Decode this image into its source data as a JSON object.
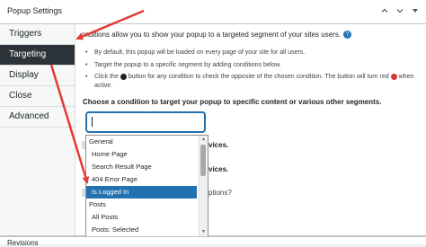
{
  "panel": {
    "title": "Popup Settings",
    "tools": {
      "up_icon": "chevron-up-icon",
      "down_icon": "chevron-down-icon",
      "toggle_icon": "triangle-toggle-icon"
    }
  },
  "tabs": [
    {
      "label": "Triggers",
      "active": false
    },
    {
      "label": "Targeting",
      "active": true
    },
    {
      "label": "Display",
      "active": false
    },
    {
      "label": "Close",
      "active": false
    },
    {
      "label": "Advanced",
      "active": false
    }
  ],
  "targeting": {
    "intro": "onditions allow you to show your popup to a targeted segment of your sites users.",
    "bullets": {
      "b1": "By default, this popup will be loaded on every page of your site for all users.",
      "b2": "Target the popup to a specific segment by adding conditions below.",
      "b3_part1": "Click the",
      "b3_part2": "button for any condition to check the opposite of the chosen condition. The button will turn red",
      "b3_part3": "when active."
    },
    "heading": "Choose a condition to target your popup to specific content or various other segments.",
    "select_value": ""
  },
  "dropdown": {
    "groups": [
      {
        "label": "General",
        "items": [
          "Home Page",
          "Search Result Page",
          "404 Error Page",
          "Is Logged In"
        ]
      },
      {
        "label": "Posts",
        "items": [
          "All Posts",
          "Posts: Selected"
        ]
      }
    ],
    "highlighted": "Is Logged In"
  },
  "behind": {
    "t1": "vices.",
    "t2": "vices.",
    "t3": "ptions?"
  },
  "footer": {
    "label": "Revisions"
  },
  "colors": {
    "accent": "#2271b1",
    "active_tab_bg": "#2c3338",
    "arrow_red": "#e53935"
  }
}
